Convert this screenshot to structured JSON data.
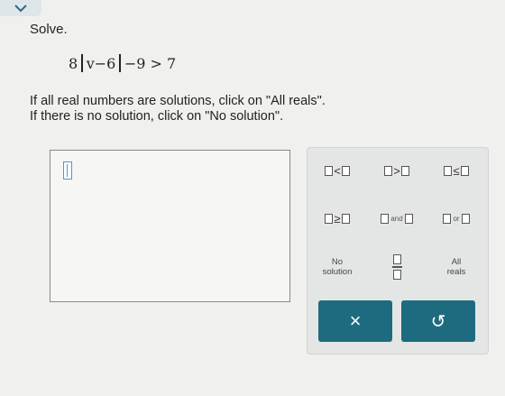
{
  "problem": {
    "prompt": "Solve.",
    "equation": {
      "coef": "8",
      "inner": "v−6",
      "rest": "−9 > 7"
    },
    "instruction_1": "If all real numbers are solutions, click on \"All reals\".",
    "instruction_2": "If there is no solution, click on \"No solution\"."
  },
  "keypad": {
    "lt": "<",
    "gt": ">",
    "le": "≤",
    "ge": "≥",
    "and_word": "and",
    "or_word": "or",
    "no_solution_1": "No",
    "no_solution_2": "solution",
    "all_reals_1": "All",
    "all_reals_2": "reals",
    "clear_symbol": "×",
    "undo_symbol": "↺"
  },
  "colors": {
    "action_button": "#1e6b80",
    "cursor": "#4a9ad2"
  },
  "icons": [
    "chevron-down-icon",
    "close-icon",
    "undo-icon"
  ]
}
